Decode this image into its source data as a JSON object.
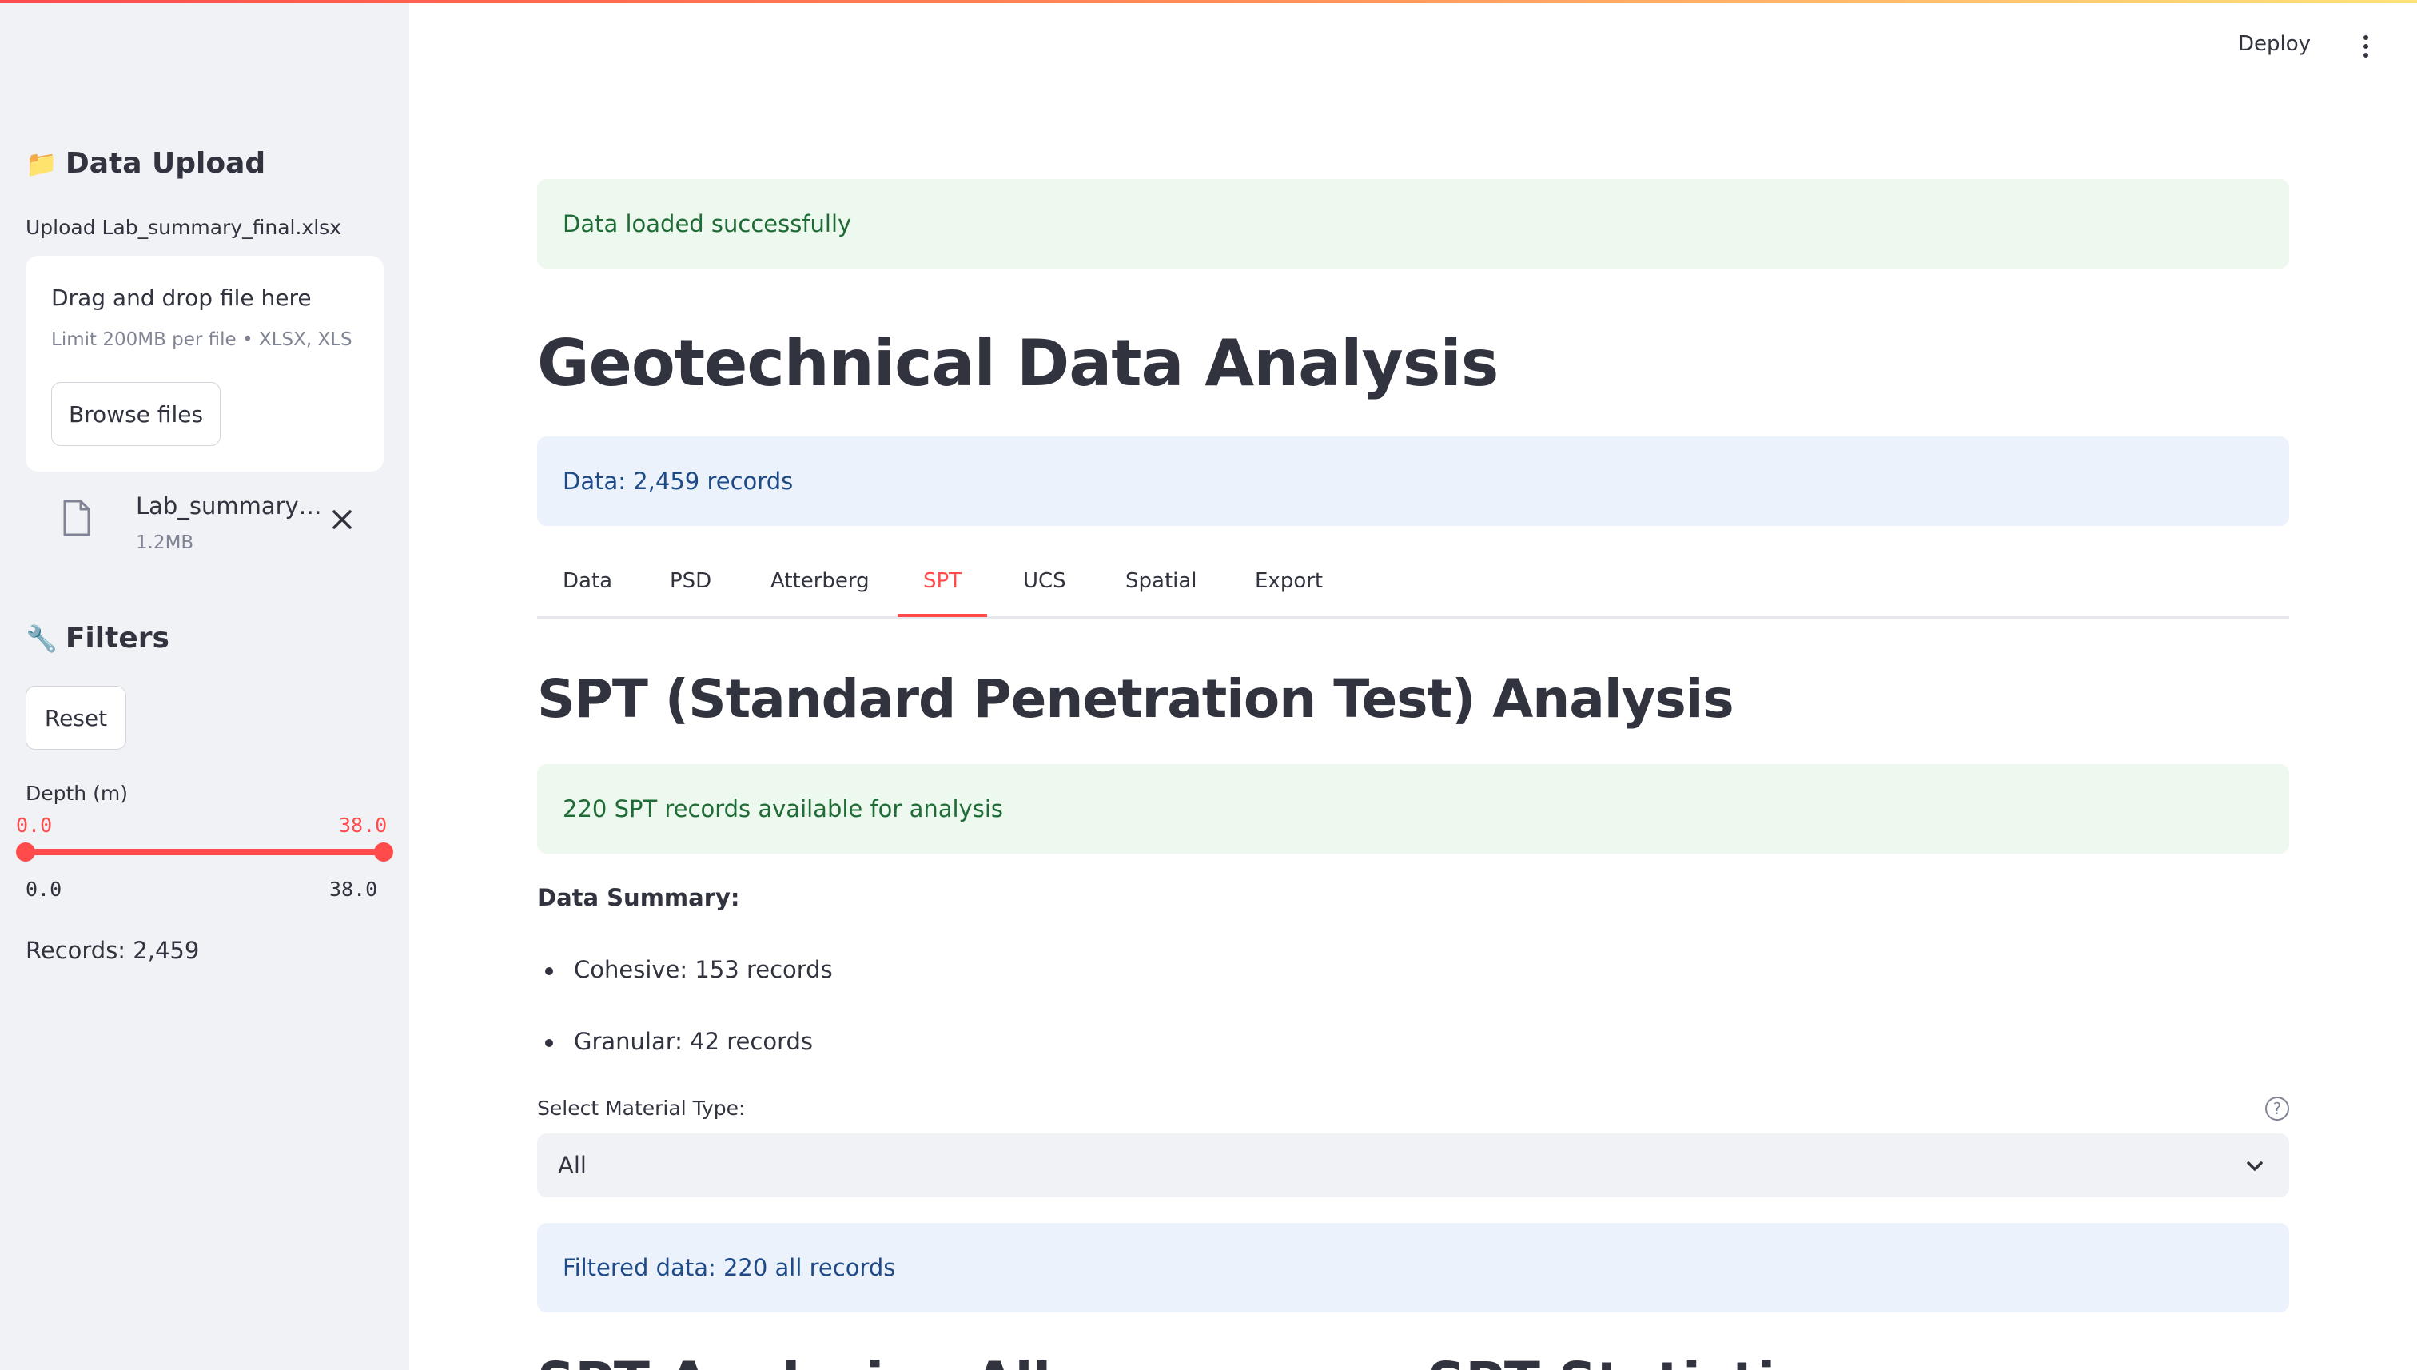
{
  "header": {
    "deploy_label": "Deploy",
    "menu_icon": "kebab-menu-icon"
  },
  "sidebar": {
    "upload_header": {
      "icon": "folder-icon",
      "emoji": "📁",
      "title": "Data Upload"
    },
    "upload_label": "Upload Lab_summary_final.xlsx",
    "dropzone": {
      "title": "Drag and drop file here",
      "subtitle": "Limit 200MB per file • XLSX, XLS",
      "browse_label": "Browse files"
    },
    "file": {
      "icon": "file-icon",
      "name": "Lab_summary…",
      "size": "1.2MB",
      "close_icon": "close-icon"
    },
    "filters_header": {
      "icon": "wrench-icon",
      "emoji": "🔧",
      "title": "Filters"
    },
    "reset_label": "Reset",
    "depth_slider": {
      "label": "Depth (m)",
      "value_low": "0.0",
      "value_high": "38.0",
      "min": "0.0",
      "max": "38.0",
      "accent": "#ff4b4b"
    },
    "records_text": "Records: 2,459"
  },
  "main": {
    "success_alert": "Data loaded successfully",
    "title": "Geotechnical Data Analysis",
    "info_records": "Data: 2,459 records",
    "tabs": [
      {
        "label": "Data"
      },
      {
        "label": "PSD"
      },
      {
        "label": "Atterberg"
      },
      {
        "label": "SPT",
        "active": true
      },
      {
        "label": "UCS"
      },
      {
        "label": "Spatial"
      },
      {
        "label": "Export"
      }
    ],
    "spt": {
      "heading": "SPT (Standard Penetration Test) Analysis",
      "available_alert": "220 SPT records available for analysis",
      "summary_title": "Data Summary:",
      "summary_items": [
        "Cohesive: 153 records",
        "Granular: 42 records"
      ],
      "select_label": "Select Material Type:",
      "select_value": "All",
      "help_icon": "help-circle-icon",
      "filtered_alert": "Filtered data: 220 all records",
      "next_heading_left": "SPT Analysis - All",
      "next_heading_right": "SPT Statistics"
    }
  }
}
